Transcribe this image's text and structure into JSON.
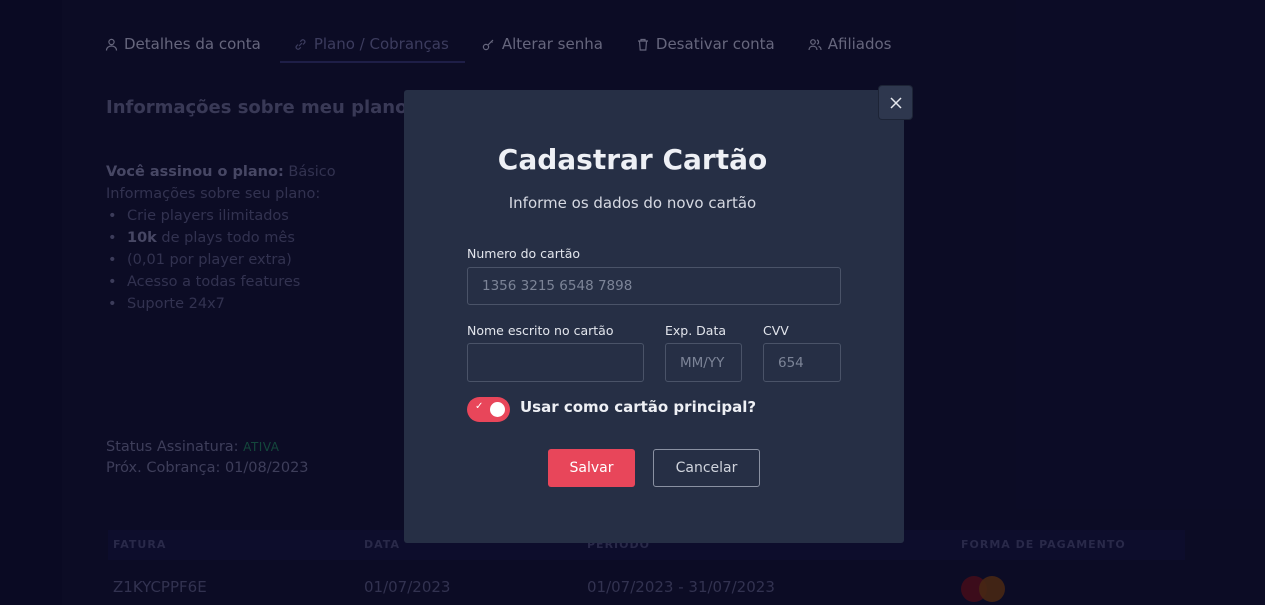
{
  "tabs": [
    {
      "label": "Detalhes da conta",
      "icon": "user-icon"
    },
    {
      "label": "Plano / Cobranças",
      "icon": "link-icon"
    },
    {
      "label": "Alterar senha",
      "icon": "key-icon"
    },
    {
      "label": "Desativar conta",
      "icon": "trash-icon"
    },
    {
      "label": "Afiliados",
      "icon": "users-icon"
    }
  ],
  "plan_section": {
    "title": "Informações sobre meu plano",
    "subscribed_label": "Você assinou o plano:",
    "subscribed_value": "Básico",
    "info_label": "Informações sobre seu plano:",
    "features": [
      {
        "bold": "",
        "text": "Crie players ilimitados"
      },
      {
        "bold": "10k",
        "text": " de plays todo mês"
      },
      {
        "bold": "",
        "text": "(0,01 por player extra)"
      },
      {
        "bold": "",
        "text": "Acesso a todas features"
      },
      {
        "bold": "",
        "text": "Suporte 24x7"
      }
    ],
    "status_label": "Status Assinatura:",
    "status_value": "ATIVA",
    "next_charge_label": "Próx. Cobrança:",
    "next_charge_value": "01/08/2023"
  },
  "invoices": {
    "headers": [
      "FATURA",
      "DATA",
      "PERÍODO",
      "FORMA DE PAGAMENTO"
    ],
    "rows": [
      {
        "invoice": "Z1KYCPPF6E",
        "date": "01/07/2023",
        "period": "01/07/2023 - 31/07/2023",
        "payment_icon": "mastercard-icon"
      }
    ]
  },
  "modal": {
    "title": "Cadastrar Cartão",
    "subtitle": "Informe os dados do novo cartão",
    "card_number_label": "Numero do cartão",
    "card_number_placeholder": "1356 3215 6548 7898",
    "name_label": "Nome escrito no cartão",
    "name_value": "",
    "exp_label": "Exp. Data",
    "exp_placeholder": "MM/YY",
    "cvv_label": "CVV",
    "cvv_placeholder": "654",
    "toggle_label": "Usar como cartão principal?",
    "toggle_on": true,
    "save_label": "Salvar",
    "cancel_label": "Cancelar",
    "close_icon": "close-icon"
  },
  "colors": {
    "accent": "#e8465a",
    "modal_bg": "#262f45",
    "page_bg": "#0d0d2c"
  }
}
